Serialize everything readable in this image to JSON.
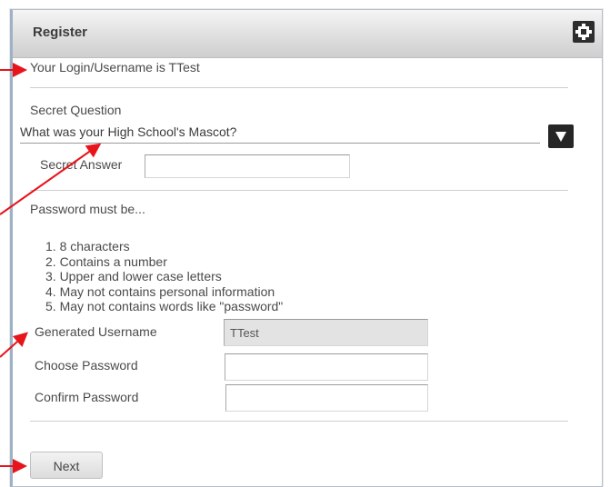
{
  "dialog": {
    "title": "Register",
    "login_message": "Your Login/Username is TTest"
  },
  "secret_question": {
    "label": "Secret Question",
    "selected": "What was your High School's Mascot?",
    "answer_label": "Secret Answer",
    "answer_value": ""
  },
  "password_rules": {
    "heading": "Password must be...",
    "items": [
      "1. 8 characters",
      "2. Contains a number",
      "3. Upper and lower case letters",
      "4. May not contains personal information",
      "5. May not contains words like \"password\""
    ]
  },
  "fields": {
    "generated_username_label": "Generated Username",
    "generated_username_value": "TTest",
    "choose_password_label": "Choose Password",
    "choose_password_value": "",
    "confirm_password_label": "Confirm Password",
    "confirm_password_value": ""
  },
  "actions": {
    "next_label": "Next"
  },
  "colors": {
    "annotation_arrow": "#e8141b",
    "titlebar": "#d9d9d9",
    "dropdown_button": "#262626"
  }
}
